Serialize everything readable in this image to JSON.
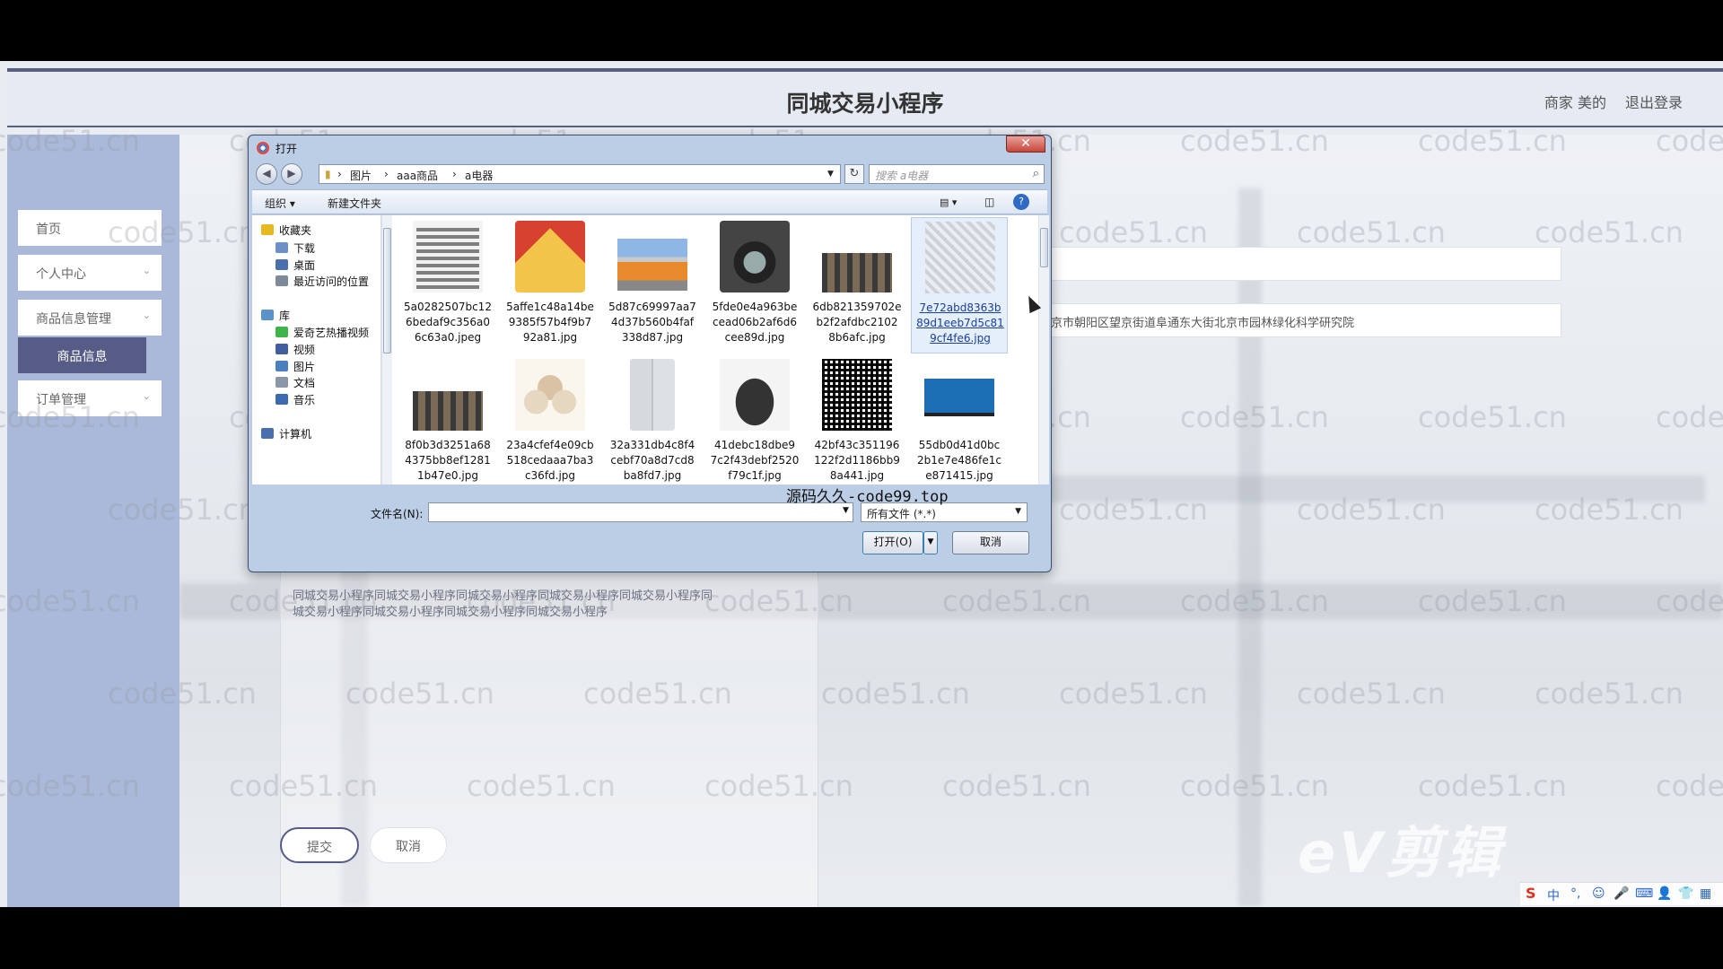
{
  "app": {
    "title": "同城交易小程序",
    "user_label": "商家 美的",
    "logout_label": "退出登录"
  },
  "sidebar": {
    "items": [
      {
        "label": "首页"
      },
      {
        "label": "个人中心",
        "chevron": "chevron-down-icon"
      },
      {
        "label": "商品信息管理",
        "chevron": "chevron-down-icon"
      },
      {
        "label": "商品信息",
        "active": true
      },
      {
        "label": "订单管理",
        "chevron": "chevron-down-icon"
      }
    ]
  },
  "form": {
    "address_value": "京市朝阳区望京街道阜通东大街北京市园林绿化科学研究院",
    "description_lines": [
      "同城交易小程序同城交易小程序同城交易小程序同城交易小程序同城交易小程序同",
      "城交易小程序同城交易小程序同城交易小程序同城交易小程序"
    ],
    "submit_label": "提交",
    "cancel_label": "取消"
  },
  "dialog": {
    "title": "打开",
    "close_glyph": "✕",
    "back_glyph": "◀",
    "forward_glyph": "▶",
    "breadcrumb": [
      "图片",
      "aaa商品",
      "a电器"
    ],
    "search_placeholder": "搜索 a电器",
    "toolbar": {
      "organize": "组织 ▾",
      "new_folder": "新建文件夹"
    },
    "nav_tree": [
      {
        "label": "收藏夹",
        "icon": "star-icon"
      },
      {
        "label": "下载",
        "icon": "download-folder-icon"
      },
      {
        "label": "桌面",
        "icon": "desktop-icon"
      },
      {
        "label": "最近访问的位置",
        "icon": "recent-places-icon"
      },
      {
        "label": "库",
        "icon": "library-icon"
      },
      {
        "label": "爱奇艺热播视频",
        "icon": "iqiyi-icon"
      },
      {
        "label": "视频",
        "icon": "video-icon"
      },
      {
        "label": "图片",
        "icon": "pictures-icon"
      },
      {
        "label": "文档",
        "icon": "documents-icon"
      },
      {
        "label": "音乐",
        "icon": "music-icon"
      },
      {
        "label": "计算机",
        "icon": "computer-icon"
      }
    ],
    "files": [
      {
        "name": [
          "5a0282507bc12",
          "6bedaf9c356a0",
          "6c63a0.jpeg"
        ],
        "thumb": "qr"
      },
      {
        "name": [
          "5affe1c48a14be",
          "9385f57b4f9b7",
          "92a81.jpg"
        ],
        "thumb": "house-qr"
      },
      {
        "name": [
          "5d87c69997aa7",
          "4d37b560b4faf",
          "338d87.jpg"
        ],
        "thumb": "warehouse"
      },
      {
        "name": [
          "5fde0e4a963be",
          "cead06b2af6d6",
          "cee89d.jpg"
        ],
        "thumb": "washer"
      },
      {
        "name": [
          "6db821359702e",
          "b2f2afdbc2102",
          "8b6afc.jpg"
        ],
        "thumb": "shelves"
      },
      {
        "name": [
          "7e72abd8363b",
          "89d1eeb7d5c81",
          "9cf4fe6.jpg"
        ],
        "thumb": "qr-faded",
        "selected": true
      },
      {
        "name": [
          "8f0b3d3251a68",
          "4375bb8ef1281",
          "1b47e0.jpg"
        ],
        "thumb": "shelves"
      },
      {
        "name": [
          "23a4cfef4e09cb",
          "518cedaaa7ba3",
          "c36fd.jpg"
        ],
        "thumb": "cookers"
      },
      {
        "name": [
          "32a331db4c8f4",
          "cebf70a8d7cd8",
          "ba8fd7.jpg"
        ],
        "thumb": "fridge"
      },
      {
        "name": [
          "41debc18dbe9",
          "7c2f43debf2520",
          "f79c1f.jpg"
        ],
        "thumb": "pan"
      },
      {
        "name": [
          "42bf43c351196",
          "122f2d1186bb9",
          "8a441.jpg"
        ],
        "thumb": "qr-dense"
      },
      {
        "name": [
          "55db0d41d0bc",
          "2b1e7e486fe1c",
          "e871415.jpg"
        ],
        "thumb": "tv"
      }
    ],
    "filename_label": "文件名(N):",
    "filename_value": "",
    "filetype_value": "所有文件 (*.*)",
    "open_label": "打开(O)",
    "cancel_label": "取消"
  },
  "overlay_text": "源码久久-code99.top",
  "watermark_text": "code51.cn",
  "editor_logo_text": "eV剪辑",
  "tray": {
    "ime": "中",
    "items": [
      "°,",
      "☺",
      "🎤",
      "⌨",
      "👤",
      "👕",
      "▦"
    ]
  }
}
